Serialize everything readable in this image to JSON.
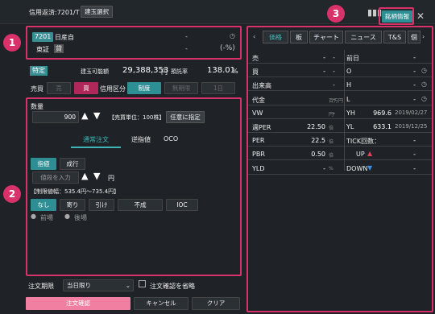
{
  "window": {
    "title": "信用返済:7201/T",
    "select_button": "建玉選択",
    "stock_info_button": "銘柄情報",
    "close": "✕"
  },
  "stock": {
    "code": "7201",
    "name": "日産自",
    "exchange": "東証",
    "exchange_badge": "貸",
    "price": "-",
    "change": "(-%)"
  },
  "account": {
    "type_badge": "特定",
    "avail_label": "建玉可能額",
    "avail_value": "29,388,353",
    "avail_unit": "円",
    "margin_label": "預託率",
    "margin_value": "138.01",
    "margin_unit": "%"
  },
  "trade": {
    "buysell_label": "売買",
    "sell": "売",
    "buy": "買",
    "credit_label": "信用区分",
    "seido": "制度",
    "mukigen": "無期限",
    "ichinichi": "1日"
  },
  "qty": {
    "label": "数量",
    "value": "900",
    "unit_text": "【売買単位：100株】",
    "any_button": "任意に指定"
  },
  "order_tabs": [
    "通常注文",
    "逆指値",
    "OCO"
  ],
  "price_type": {
    "limit": "指値",
    "market": "成行",
    "placeholder": "値段を入力",
    "unit": "円",
    "range": "【制限値幅：535.4円〜735.4円】"
  },
  "conditions": [
    "なし",
    "寄り",
    "引け",
    "不成",
    "IOC"
  ],
  "session": [
    "前場",
    "後場"
  ],
  "expiry": {
    "label": "注文期限",
    "value": "当日限り",
    "skip_confirm": "注文確認を省略"
  },
  "actions": {
    "confirm": "注文確認",
    "cancel": "キャンセル",
    "clear": "クリア"
  },
  "right_tabs": [
    "価格",
    "板",
    "チャート",
    "ニュース",
    "T&S",
    "個"
  ],
  "left_rows": [
    {
      "label": "売",
      "v1": "-",
      "v2": "-"
    },
    {
      "label": "買",
      "v1": "-",
      "v2": "-"
    },
    {
      "label": "出来高",
      "v1": "",
      "v2": "-"
    },
    {
      "label": "代金",
      "v1": "",
      "v2": "-",
      "unit": "百万円"
    },
    {
      "label": "VW",
      "v1": "",
      "v2": "-",
      "unit": "円"
    },
    {
      "label": "週PER",
      "v1": "22.50",
      "v2": "",
      "unit": "倍"
    },
    {
      "label": "PER",
      "v1": "22.5",
      "v2": "",
      "unit": "倍"
    },
    {
      "label": "PBR",
      "v1": "0.50",
      "v2": "",
      "unit": "倍"
    },
    {
      "label": "YLD",
      "v1": "-",
      "v2": "",
      "unit": "%"
    }
  ],
  "right_rows": [
    {
      "label": "前日",
      "value": "-"
    },
    {
      "label": "O",
      "value": "-"
    },
    {
      "label": "H",
      "value": "-"
    },
    {
      "label": "L",
      "value": "-"
    },
    {
      "label": "YH",
      "value": "969.6",
      "date": "2019/02/27"
    },
    {
      "label": "YL",
      "value": "633.1",
      "date": "2019/12/25"
    },
    {
      "label": "TICK回数：",
      "value": "-"
    },
    {
      "label": "UP",
      "value": "-"
    },
    {
      "label": "DOWN",
      "value": "-"
    }
  ],
  "colors": {
    "accent": "#d9316a",
    "teal": "#2d8f94",
    "up": "#e0405a",
    "down": "#3b8fe0"
  }
}
